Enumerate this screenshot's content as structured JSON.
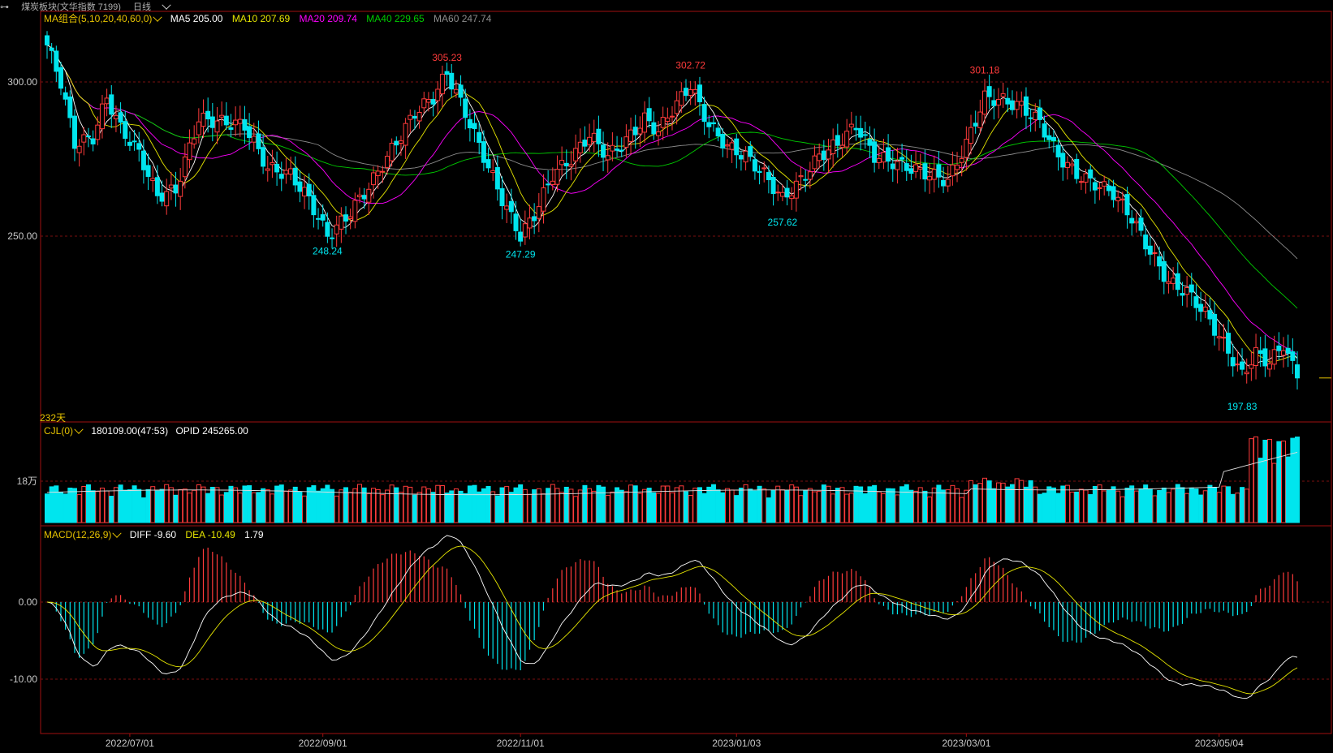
{
  "topbar": {
    "link_icon": "link-icon",
    "title": "煤炭板块(文华指数 7199)",
    "period": "日线"
  },
  "colors": {
    "up": "#ff3b3b",
    "down": "#00e5ee",
    "ma5": "#ffffff",
    "ma10": "#e6e600",
    "ma20": "#ff00ff",
    "ma40": "#00cc00",
    "ma60": "#8c8c8c",
    "grid": "#7a1010",
    "label_gold": "#e6c200"
  },
  "price_panel": {
    "legend_label": "MA组合(5,10,20,40,60,0)",
    "ma5": "MA5 205.00",
    "ma10": "MA10 207.69",
    "ma20": "MA20 209.74",
    "ma40": "MA40 229.65",
    "ma60": "MA60 247.74",
    "days_label": "232天",
    "y_ticks": [
      "300.00",
      "250.00"
    ],
    "annotations": {
      "h1": "305.23",
      "h2": "302.72",
      "h3": "301.18",
      "l1": "248.24",
      "l2": "247.29",
      "l3": "257.62",
      "l4": "197.83"
    }
  },
  "volume_panel": {
    "legend_label": "CJL(0)",
    "values": "180109.00(47:53)",
    "opid": "OPID 245265.00",
    "y_tick": "18万"
  },
  "macd_panel": {
    "legend_label": "MACD(12,26,9)",
    "diff": "DIFF -9.60",
    "dea": "DEA -10.49",
    "macd": "1.79",
    "y_ticks": [
      "0.00",
      "-10.00"
    ]
  },
  "x_axis": {
    "labels": [
      "2022/07/01",
      "2022/09/01",
      "2022/11/01",
      "2023/01/03",
      "2023/03/01",
      "2023/05/04"
    ]
  },
  "chart_data": {
    "type": "candlestick",
    "y_range": [
      195,
      315
    ],
    "anchors": [
      [
        0,
        312
      ],
      [
        3,
        300
      ],
      [
        6,
        280
      ],
      [
        10,
        282
      ],
      [
        13,
        295
      ],
      [
        16,
        285
      ],
      [
        20,
        277
      ],
      [
        24,
        263
      ],
      [
        28,
        265
      ],
      [
        33,
        288
      ],
      [
        38,
        287
      ],
      [
        43,
        286
      ],
      [
        48,
        272
      ],
      [
        53,
        270
      ],
      [
        57,
        262
      ],
      [
        61,
        250
      ],
      [
        65,
        256
      ],
      [
        70,
        266
      ],
      [
        75,
        278
      ],
      [
        80,
        290
      ],
      [
        84,
        295
      ],
      [
        87,
        303
      ],
      [
        91,
        290
      ],
      [
        95,
        276
      ],
      [
        99,
        262
      ],
      [
        103,
        250
      ],
      [
        106,
        257
      ],
      [
        110,
        270
      ],
      [
        114,
        275
      ],
      [
        118,
        283
      ],
      [
        122,
        276
      ],
      [
        126,
        281
      ],
      [
        130,
        288
      ],
      [
        133,
        284
      ],
      [
        136,
        291
      ],
      [
        140,
        299
      ],
      [
        144,
        286
      ],
      [
        148,
        279
      ],
      [
        152,
        276
      ],
      [
        156,
        270
      ],
      [
        160,
        262
      ],
      [
        164,
        268
      ],
      [
        168,
        276
      ],
      [
        172,
        280
      ],
      [
        176,
        286
      ],
      [
        180,
        276
      ],
      [
        184,
        274
      ],
      [
        188,
        272
      ],
      [
        192,
        270
      ],
      [
        196,
        268
      ],
      [
        200,
        280
      ],
      [
        204,
        295
      ],
      [
        208,
        294
      ],
      [
        212,
        292
      ],
      [
        216,
        287
      ],
      [
        220,
        276
      ],
      [
        224,
        270
      ],
      [
        228,
        267
      ],
      [
        232,
        264
      ],
      [
        236,
        256
      ],
      [
        240,
        245
      ],
      [
        244,
        235
      ],
      [
        248,
        232
      ],
      [
        252,
        225
      ],
      [
        256,
        215
      ],
      [
        260,
        205
      ],
      [
        263,
        212
      ],
      [
        266,
        209
      ],
      [
        269,
        215
      ],
      [
        272,
        204
      ]
    ],
    "ma_values": {
      "MA5": 205.0,
      "MA10": 207.69,
      "MA20": 209.74,
      "MA40": 229.65,
      "MA60": 247.74
    },
    "highs": [
      305.23,
      302.72,
      301.18
    ],
    "lows": [
      248.24,
      247.29,
      257.62,
      197.83
    ],
    "volume": {
      "last": 180109.0,
      "opid": 245265.0
    },
    "macd": {
      "diff": -9.6,
      "dea": -10.49,
      "macd": 1.79
    }
  }
}
